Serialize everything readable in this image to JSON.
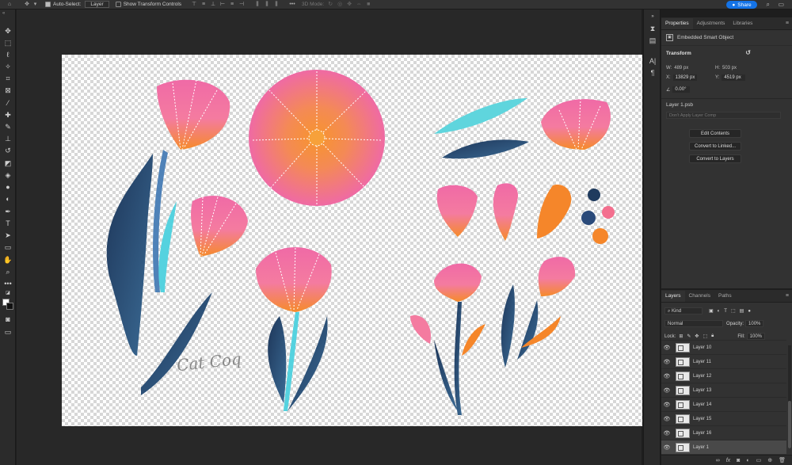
{
  "options_bar": {
    "home_icon": "home-icon",
    "move_icon": "move-tool-icon",
    "auto_select_label": "Auto-Select:",
    "auto_select_checked": true,
    "auto_select_target": "Layer",
    "transform_controls_label": "Show Transform Controls",
    "transform_controls_checked": false,
    "three_d_mode_label": "3D Mode:",
    "more_icon": "ellipsis-icon",
    "share_label": "Share",
    "search_icon": "search-icon",
    "workspace_icon": "workspace-icon"
  },
  "toolbar": {
    "tools": [
      "move-tool",
      "marquee-tool",
      "lasso-tool",
      "magic-wand-tool",
      "crop-tool",
      "frame-tool",
      "eyedropper-tool",
      "healing-brush-tool",
      "brush-tool",
      "clone-stamp-tool",
      "history-brush-tool",
      "eraser-tool",
      "paint-bucket-tool",
      "blur-tool",
      "dodge-tool",
      "pen-tool",
      "type-tool",
      "path-selection-tool",
      "rectangle-tool",
      "hand-tool",
      "zoom-tool",
      "edit-toolbar",
      "default-colors",
      "foreground-color",
      "quick-mask",
      "screen-mode"
    ],
    "foreground_color": "#ffffff",
    "background_color": "#111111"
  },
  "canvas": {
    "signature_text": "Cat Coq"
  },
  "properties_panel": {
    "tabs": [
      "Properties",
      "Adjustments",
      "Libraries"
    ],
    "active_tab": "Properties",
    "object_type": "Embedded Smart Object",
    "transform_title": "Transform",
    "w_label": "W:",
    "w_value": "489 px",
    "h_label": "H:",
    "h_value": "503 px",
    "x_label": "X:",
    "x_value": "13829 px",
    "y_label": "Y:",
    "y_value": "4519 px",
    "angle_value": "0.00°",
    "layer_file": "Layer 1.psb",
    "layer_comp_placeholder": "Don't Apply Layer Comp",
    "buttons": [
      "Edit Contents",
      "Convert to Linked...",
      "Convert to Layers"
    ]
  },
  "layers_panel": {
    "tabs": [
      "Layers",
      "Channels",
      "Paths"
    ],
    "active_tab": "Layers",
    "filter_kind": "Kind",
    "blend_mode": "Normal",
    "opacity_label": "Opacity:",
    "opacity_value": "100%",
    "lock_label": "Lock:",
    "fill_label": "Fill:",
    "fill_value": "100%",
    "layers": [
      {
        "name": "Layer 10",
        "selected": false
      },
      {
        "name": "Layer 11",
        "selected": false
      },
      {
        "name": "Layer 12",
        "selected": false
      },
      {
        "name": "Layer 13",
        "selected": false
      },
      {
        "name": "Layer 14",
        "selected": false
      },
      {
        "name": "Layer 15",
        "selected": false
      },
      {
        "name": "Layer 16",
        "selected": false
      },
      {
        "name": "Layer 1",
        "selected": true
      }
    ],
    "footer_icons": [
      "link-icon",
      "fx-icon",
      "mask-icon",
      "adjustment-icon",
      "group-icon",
      "new-layer-icon",
      "trash-icon"
    ]
  }
}
